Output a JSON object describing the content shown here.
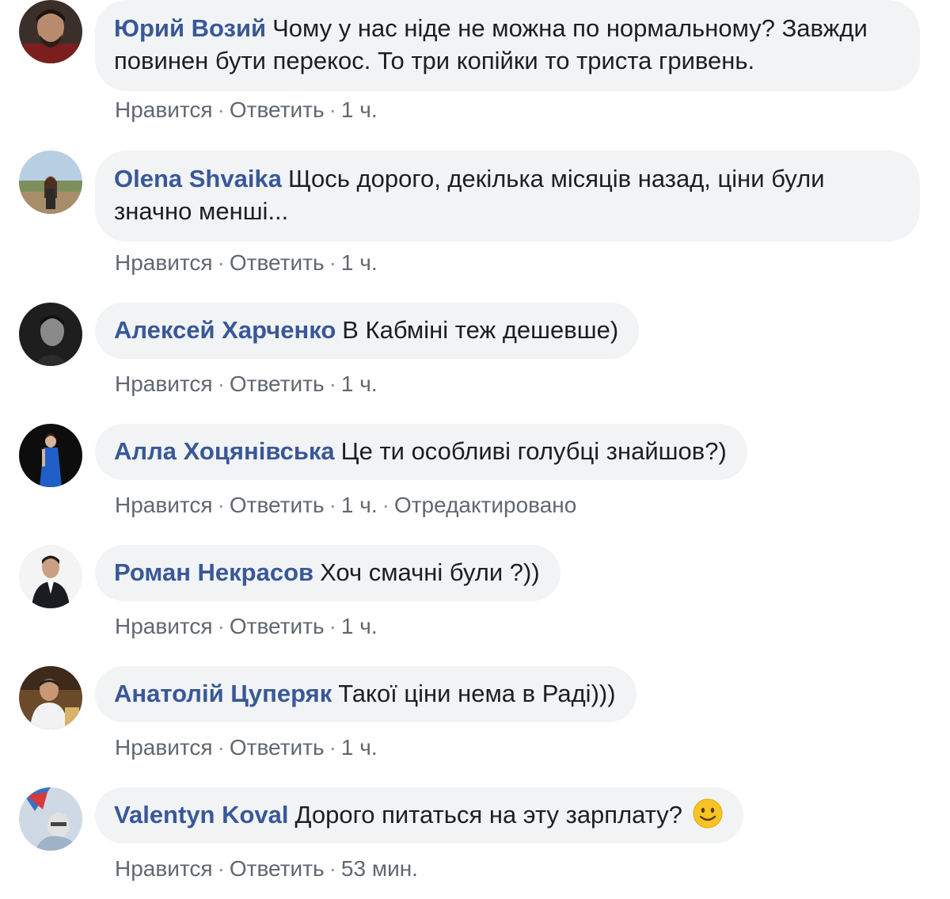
{
  "comments": [
    {
      "author": "Юрий Возий",
      "text": "Чому у нас ніде не можна по нормальному? Завжди повинен бути перекос. То три копійки то триста гривень.",
      "like": "Нравится",
      "reply": "Ответить",
      "time": "1 ч."
    },
    {
      "author": "Olena Shvaika",
      "text": "Щось дорого, декілька місяців назад, ціни були значно менші...",
      "like": "Нравится",
      "reply": "Ответить",
      "time": "1 ч."
    },
    {
      "author": "Алексей Харченко",
      "text": "В Кабміні теж дешевше)",
      "like": "Нравится",
      "reply": "Ответить",
      "time": "1 ч."
    },
    {
      "author": "Алла Хоцянівська",
      "text": "Це ти особливі голубці знайшов?)",
      "like": "Нравится",
      "reply": "Ответить",
      "time": "1 ч.",
      "edited": "Отредактировано"
    },
    {
      "author": "Роман Некрасов",
      "text": "Хоч смачні були ?))",
      "like": "Нравится",
      "reply": "Ответить",
      "time": "1 ч."
    },
    {
      "author": "Анатолій Цуперяк",
      "text": "Такої ціни нема в Раді)))",
      "like": "Нравится",
      "reply": "Ответить",
      "time": "1 ч."
    },
    {
      "author": "Valentyn Koval",
      "text": "Дорого питаться на эту зарплату?",
      "emoji": "slightly-smiling-face-icon",
      "like": "Нравится",
      "reply": "Ответить",
      "time": "53 мин."
    }
  ],
  "colors": {
    "author": "#385898",
    "bubble": "#f2f3f5",
    "text": "#1c1e21",
    "meta": "#606770"
  }
}
